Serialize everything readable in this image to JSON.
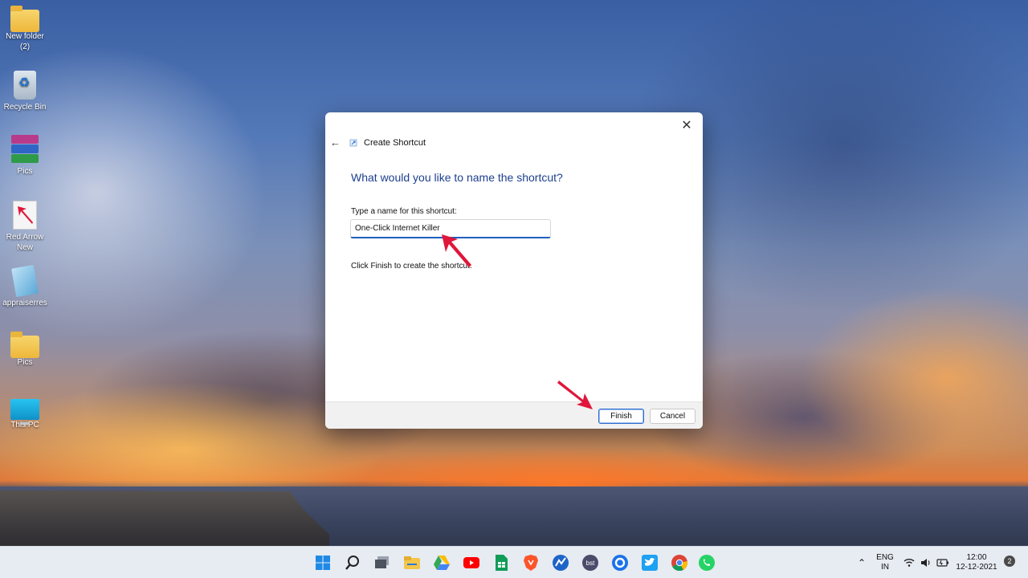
{
  "desktop": {
    "icons": [
      {
        "label": "New folder (2)"
      },
      {
        "label": "Recycle Bin"
      },
      {
        "label": "Pics"
      },
      {
        "label": "Red Arrow New"
      },
      {
        "label": "appraiserres"
      },
      {
        "label": "Pics"
      },
      {
        "label": "This PC"
      }
    ]
  },
  "dialog": {
    "title": "Create Shortcut",
    "heading": "What would you like to name the shortcut?",
    "field_label": "Type a name for this shortcut:",
    "name_value": "One-Click Internet Killer",
    "finish_instruction": "Click Finish to create the shortcut.",
    "finish_button": "Finish",
    "cancel_button": "Cancel",
    "close_glyph": "✕",
    "back_glyph": "←"
  },
  "taskbar": {
    "icons": [
      "windows-start-icon",
      "search-icon",
      "task-view-icon",
      "file-explorer-icon",
      "google-drive-icon",
      "youtube-icon",
      "google-sheets-icon",
      "brave-browser-icon",
      "maps-icon",
      "bst-icon",
      "circle-app-icon",
      "twitter-icon",
      "chrome-icon",
      "whatsapp-icon"
    ],
    "language_line1": "ENG",
    "language_line2": "IN",
    "time": "12:00",
    "date": "12-12-2021",
    "notification_count": "2"
  },
  "colors": {
    "heading_blue": "#1d3f8f",
    "input_underline": "#1f5fbf",
    "annotation_red": "#e0163a"
  }
}
